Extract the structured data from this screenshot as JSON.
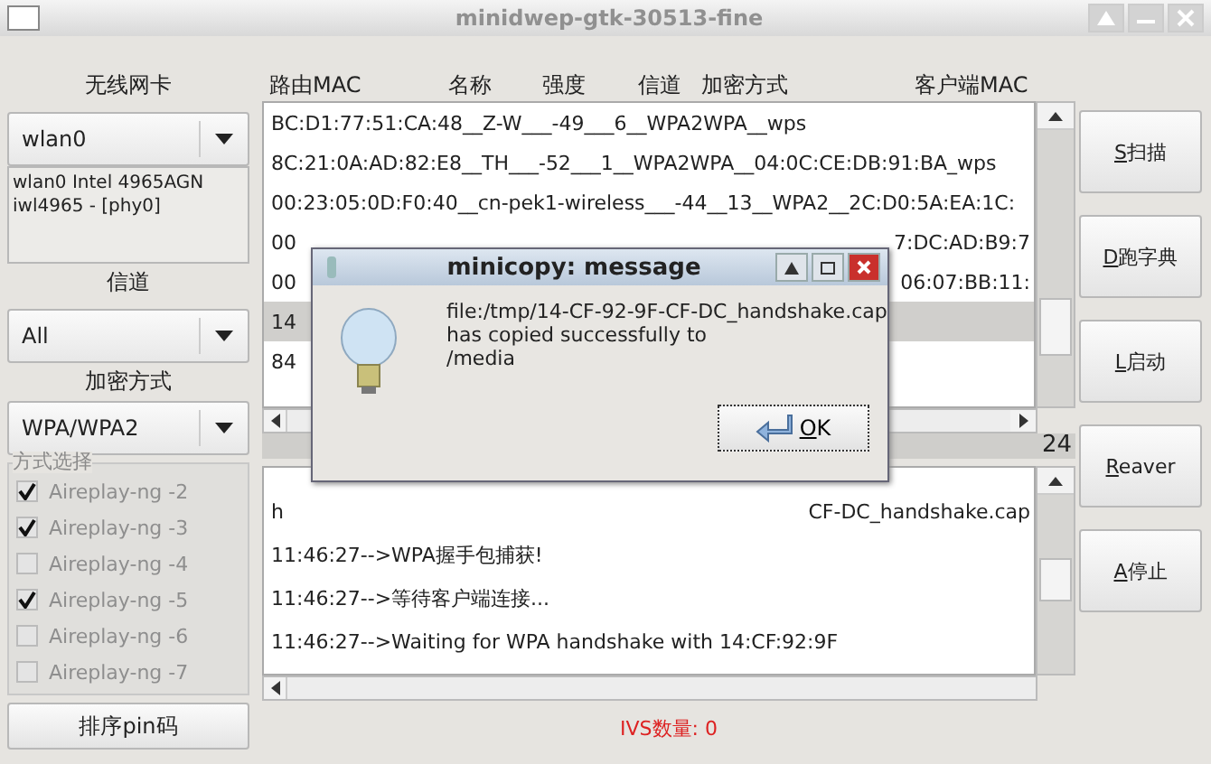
{
  "window": {
    "title": "minidwep-gtk-30513-fine"
  },
  "left": {
    "card_label": "无线网卡",
    "card": {
      "value": "wlan0"
    },
    "card_info": [
      "wlan0 Intel 4965AGN",
      "iwl4965 - [phy0]"
    ],
    "channel_label": "信道",
    "channel": {
      "value": "All"
    },
    "encryption_label": "加密方式",
    "encryption": {
      "value": "WPA/WPA2"
    },
    "methods": {
      "title": "方式选择",
      "items": [
        {
          "label": "Aireplay-ng -2",
          "checked": true,
          "disabled": true
        },
        {
          "label": "Aireplay-ng -3",
          "checked": true,
          "disabled": true
        },
        {
          "label": "Aireplay-ng -4",
          "checked": false,
          "disabled": true
        },
        {
          "label": "Aireplay-ng -5",
          "checked": true,
          "disabled": true
        },
        {
          "label": "Aireplay-ng -6",
          "checked": false,
          "disabled": true
        },
        {
          "label": "Aireplay-ng -7",
          "checked": false,
          "disabled": true
        }
      ]
    },
    "sort_button": "排序pin码"
  },
  "table": {
    "columns": [
      "路由MAC",
      "名称",
      "强度",
      "信道",
      "加密方式",
      "客户端MAC"
    ],
    "rows": [
      {
        "start": "BC:D1:77:51:CA:48__Z-W___-49___6__WPA2WPA__wps",
        "selected": false
      },
      {
        "start": "8C:21:0A:AD:82:E8__TH___-52___1__WPA2WPA__04:0C:CE:DB:91:BA_wps",
        "selected": false
      },
      {
        "start": "00:23:05:0D:F0:40__cn-pek1-wireless___-44__13__WPA2__2C:D0:5A:EA:1C:",
        "selected": false
      },
      {
        "start": "00",
        "end": "7:DC:AD:B9:7",
        "selected": false
      },
      {
        "start": "00",
        "end": "06:07:BB:11:",
        "selected": false
      },
      {
        "start": "14",
        "selected": true
      },
      {
        "start": "84",
        "selected": false
      }
    ],
    "count": "24"
  },
  "log": {
    "lines": [
      {
        "start": "h",
        "end": "CF-DC_handshake.cap"
      },
      {
        "start": "11:46:27-->WPA握手包捕获!"
      },
      {
        "start": "11:46:27-->等待客户端连接..."
      },
      {
        "start": "11:46:27-->Waiting for WPA handshake with 14:CF:92:9F"
      }
    ]
  },
  "status": "IVS数量: 0",
  "buttons": [
    "S扫描",
    "D跑字典",
    "L启动",
    "Reaver",
    "A停止"
  ],
  "dialog": {
    "title": "minicopy: message",
    "message": [
      "file:/tmp/14-CF-92-9F-CF-DC_handshake.cap",
      "has copied successfully to",
      "/media"
    ],
    "ok": "OK"
  }
}
